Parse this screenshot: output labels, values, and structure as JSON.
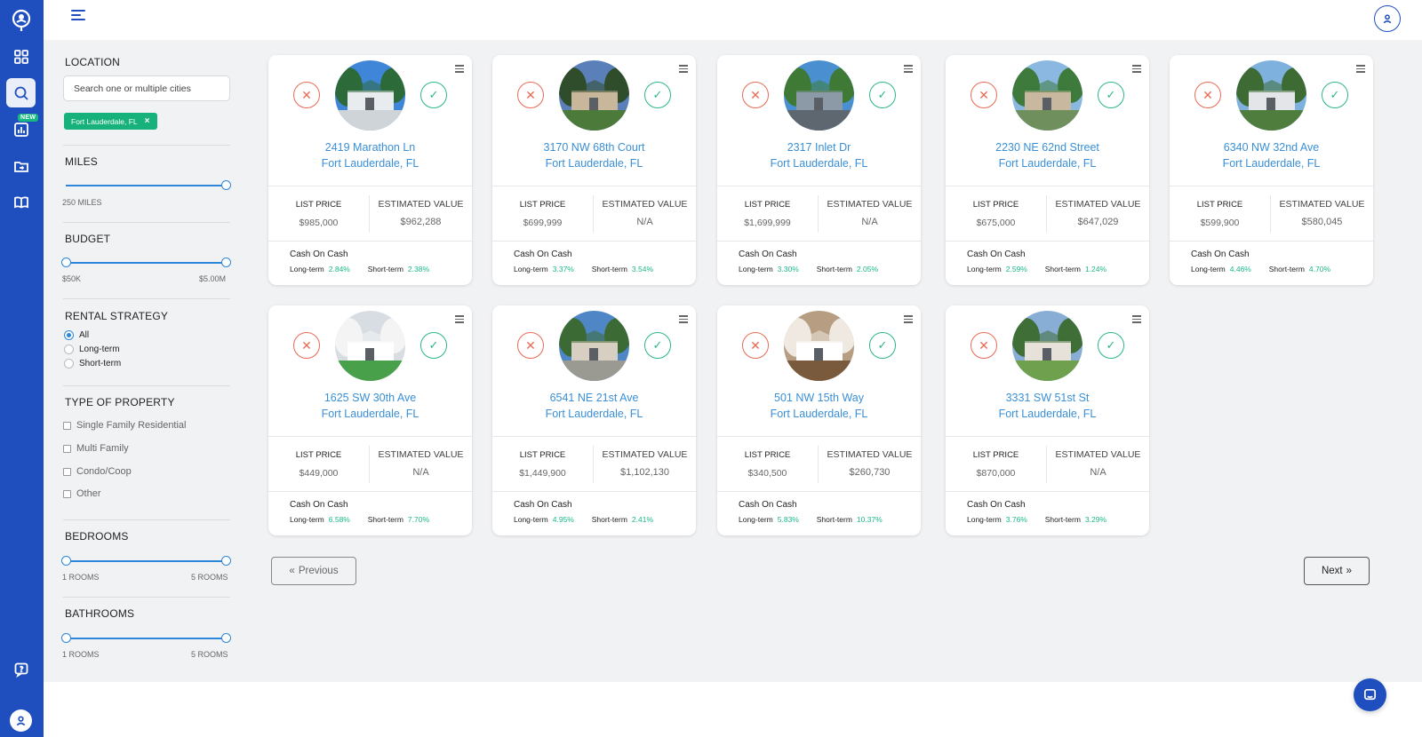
{
  "nav": {
    "items": [
      {
        "name": "dashboard",
        "icon": "grid-icon"
      },
      {
        "name": "search",
        "icon": "search-icon",
        "active": true
      },
      {
        "name": "analytics",
        "icon": "bar-chart-icon",
        "badge": "NEW"
      },
      {
        "name": "portfolio",
        "icon": "folder-icon"
      },
      {
        "name": "learn",
        "icon": "book-icon"
      }
    ],
    "help_icon": "help-chat-icon",
    "user_icon": "user-icon"
  },
  "filters": {
    "location": {
      "title": "LOCATION",
      "placeholder": "Search one or multiple cities",
      "chip": "Fort Lauderdale, FL",
      "chip_remove": "×"
    },
    "miles": {
      "title": "MILES",
      "value_label": "250 MILES",
      "value_fraction": 1.0
    },
    "budget": {
      "title": "BUDGET",
      "min_label": "$50K",
      "max_label": "$5.00M"
    },
    "rental_strategy": {
      "title": "RENTAL STRATEGY",
      "options": [
        "All",
        "Long-term",
        "Short-term"
      ],
      "selected": "All"
    },
    "property_type": {
      "title": "TYPE OF PROPERTY",
      "options": [
        "Single Family Residential",
        "Multi Family",
        "Condo/Coop",
        "Other"
      ]
    },
    "bedrooms": {
      "title": "BEDROOMS",
      "min_label": "1 ROOMS",
      "max_label": "5 ROOMS"
    },
    "bathrooms": {
      "title": "BATHROOMS",
      "min_label": "1 ROOMS",
      "max_label": "5 ROOMS"
    }
  },
  "labels": {
    "list_price": "LIST PRICE",
    "estimated_value": "ESTIMATED VALUE",
    "cash_on_cash": "Cash On Cash",
    "long_term": "Long-term",
    "short_term": "Short-term"
  },
  "properties": [
    {
      "street": "2419 Marathon Ln",
      "city": "Fort Lauderdale, FL",
      "list_price": "$985,000",
      "est_value": "$962,288",
      "long_term": "2.84%",
      "short_term": "2.38%"
    },
    {
      "street": "3170 NW 68th Court",
      "city": "Fort Lauderdale, FL",
      "list_price": "$699,999",
      "est_value": "N/A",
      "long_term": "3.37%",
      "short_term": "3.54%"
    },
    {
      "street": "2317 Inlet Dr",
      "city": "Fort Lauderdale, FL",
      "list_price": "$1,699,999",
      "est_value": "N/A",
      "long_term": "3.30%",
      "short_term": "2.05%"
    },
    {
      "street": "2230 NE 62nd Street",
      "city": "Fort Lauderdale, FL",
      "list_price": "$675,000",
      "est_value": "$647,029",
      "long_term": "2.59%",
      "short_term": "1.24%"
    },
    {
      "street": "6340 NW 32nd Ave",
      "city": "Fort Lauderdale, FL",
      "list_price": "$599,900",
      "est_value": "$580,045",
      "long_term": "4.46%",
      "short_term": "4.70%"
    },
    {
      "street": "1625 SW 30th Ave",
      "city": "Fort Lauderdale, FL",
      "list_price": "$449,000",
      "est_value": "N/A",
      "long_term": "6.58%",
      "short_term": "7.70%"
    },
    {
      "street": "6541 NE 21st Ave",
      "city": "Fort Lauderdale, FL",
      "list_price": "$1,449,900",
      "est_value": "$1,102,130",
      "long_term": "4.95%",
      "short_term": "2.41%"
    },
    {
      "street": "501 NW 15th Way",
      "city": "Fort Lauderdale, FL",
      "list_price": "$340,500",
      "est_value": "$260,730",
      "long_term": "5.83%",
      "short_term": "10.37%"
    },
    {
      "street": "3331 SW 51st St",
      "city": "Fort Lauderdale, FL",
      "list_price": "$870,000",
      "est_value": "N/A",
      "long_term": "3.76%",
      "short_term": "3.29%"
    }
  ],
  "pagination": {
    "previous": "Previous",
    "next": "Next"
  },
  "colors": {
    "brand": "#1f4fbf",
    "accent_blue": "#2d86d8",
    "positive_green": "#1ab88a",
    "reject_red": "#e86a55",
    "chip_green": "#17b27b"
  }
}
